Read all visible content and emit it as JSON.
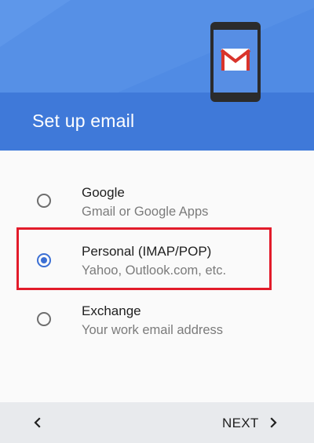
{
  "header": {
    "title": "Set up email"
  },
  "options": [
    {
      "title": "Google",
      "subtitle": "Gmail or Google Apps",
      "selected": false
    },
    {
      "title": "Personal (IMAP/POP)",
      "subtitle": "Yahoo, Outlook.com, etc.",
      "selected": true
    },
    {
      "title": "Exchange",
      "subtitle": "Your work email address",
      "selected": false
    }
  ],
  "footer": {
    "back_icon": "chevron-left-icon",
    "next_label": "NEXT",
    "next_icon": "chevron-right-icon"
  },
  "colors": {
    "header_light": "#5690e6",
    "header_dark": "#3f79d9",
    "accent": "#3b6fd4",
    "highlight": "#e21b2a"
  }
}
